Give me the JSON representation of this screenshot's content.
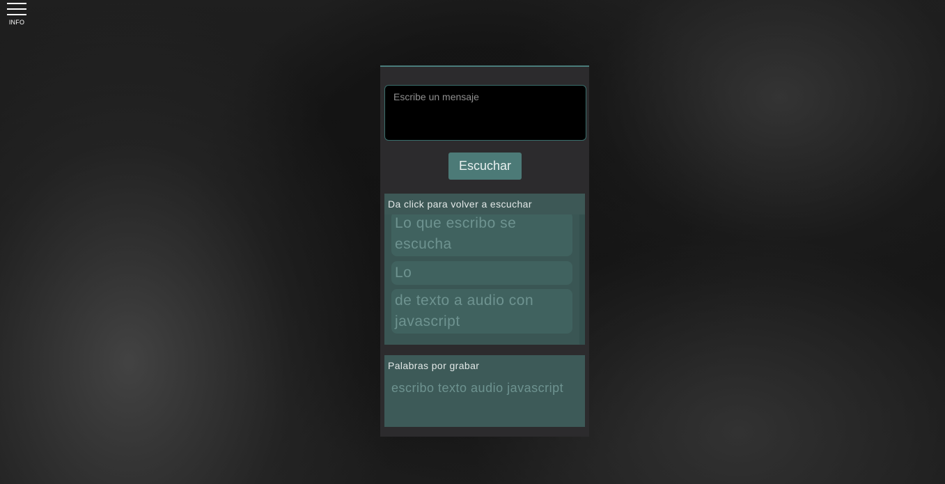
{
  "menu": {
    "label": "INFO"
  },
  "message": {
    "placeholder": "Escribe un mensaje",
    "value": ""
  },
  "listen_button": {
    "label": "Escuchar"
  },
  "history": {
    "header": "Da click para volver a escuchar",
    "items": [
      "Lo que escribo se escucha",
      "Lo",
      "de texto a audio con javascript"
    ]
  },
  "pending": {
    "header": "Palabras por grabar",
    "words": "escribo texto audio javascript"
  },
  "colors": {
    "accent": "#4c7a77",
    "panel": "#2c2b2d",
    "box": "#3b5755"
  }
}
